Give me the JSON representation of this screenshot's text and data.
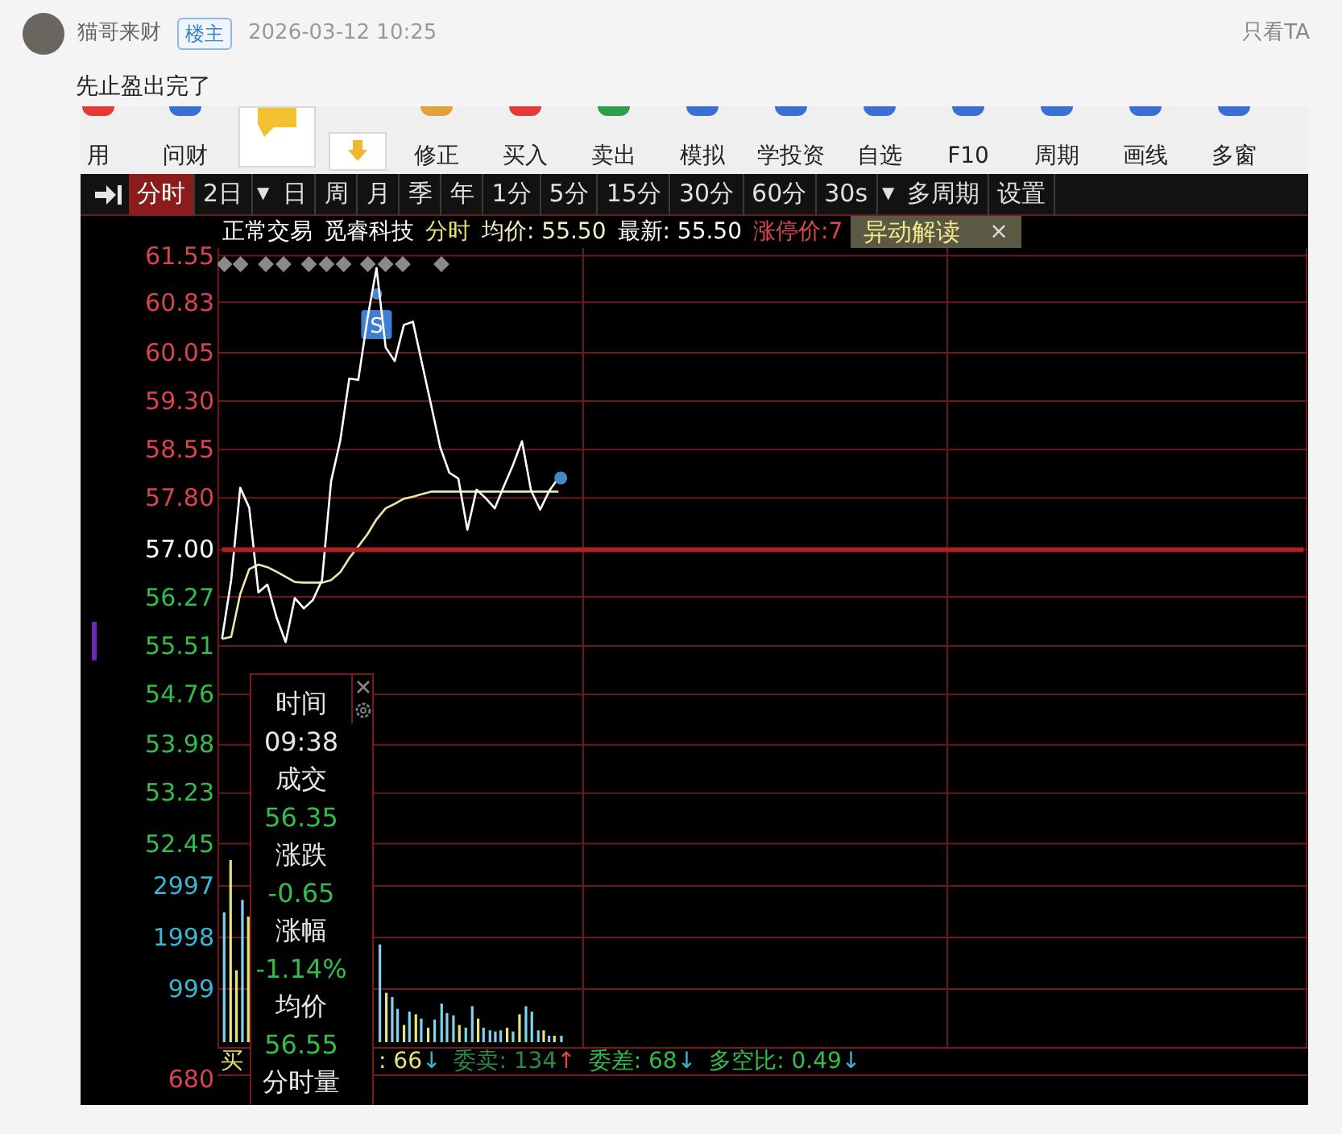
{
  "post": {
    "author": "猫哥来财",
    "badge": "楼主",
    "time": "2026-03-12 10:25",
    "only_author_link": "只看TA",
    "text": "先止盈出完了"
  },
  "screenshot": {
    "toolbar": [
      {
        "kind": "button",
        "label": "用"
      },
      {
        "kind": "button",
        "label": "问财"
      },
      {
        "kind": "wide"
      },
      {
        "kind": "small"
      },
      {
        "kind": "button",
        "label": "修正"
      },
      {
        "kind": "button",
        "label": "买入"
      },
      {
        "kind": "button",
        "label": "卖出"
      },
      {
        "kind": "button",
        "label": "模拟"
      },
      {
        "kind": "button",
        "label": "学投资"
      },
      {
        "kind": "button",
        "label": "自选"
      },
      {
        "kind": "button",
        "label": "F10"
      },
      {
        "kind": "button",
        "label": "周期"
      },
      {
        "kind": "button",
        "label": "画线"
      },
      {
        "kind": "button",
        "label": "多窗"
      }
    ],
    "period_tabs": [
      {
        "kind": "tab",
        "label": "分时",
        "selected": true
      },
      {
        "kind": "tab",
        "label": "2日",
        "selected": false
      },
      {
        "kind": "caret",
        "label": "▼",
        "selected": false
      },
      {
        "kind": "tab",
        "label": "日",
        "selected": false
      },
      {
        "kind": "tab",
        "label": "周",
        "selected": false
      },
      {
        "kind": "tab",
        "label": "月",
        "selected": false
      },
      {
        "kind": "tab",
        "label": "季",
        "selected": false
      },
      {
        "kind": "tab",
        "label": "年",
        "selected": false
      },
      {
        "kind": "tab",
        "label": "1分",
        "selected": false
      },
      {
        "kind": "tab",
        "label": "5分",
        "selected": false
      },
      {
        "kind": "tab",
        "label": "15分",
        "selected": false
      },
      {
        "kind": "tab",
        "label": "30分",
        "selected": false
      },
      {
        "kind": "tab",
        "label": "60分",
        "selected": false
      },
      {
        "kind": "tab",
        "label": "30s",
        "selected": false
      },
      {
        "kind": "caret",
        "label": "▼",
        "selected": false
      },
      {
        "kind": "tab",
        "label": "多周期",
        "selected": false
      },
      {
        "kind": "tab",
        "label": "设置",
        "selected": false
      }
    ],
    "info": [
      {
        "text": "正常交易",
        "color": "#ffffff"
      },
      {
        "text": "觅睿科技",
        "color": "#ffffff"
      },
      {
        "text": "分时",
        "color": "#e6e37a"
      },
      {
        "text": "均价: 55.50",
        "color": "#f3f0c0"
      },
      {
        "text": "最新: 55.50",
        "color": "#ffffff"
      },
      {
        "text": "涨停价:7",
        "color": "#e0474c"
      }
    ],
    "popup": {
      "label": "异动解读",
      "close": "×"
    },
    "volume_axis": [
      {
        "text": "2997"
      },
      {
        "text": "1998"
      },
      {
        "text": "999"
      }
    ],
    "lower_axis": "680",
    "price_axis": [
      {
        "color": "#d9434b"
      },
      {
        "color": "#d9434b"
      },
      {
        "color": "#d9434b"
      },
      {
        "color": "#d9434b"
      },
      {
        "color": "#d9434b"
      },
      {
        "color": "#d9434b"
      },
      {
        "color": "#ffffff"
      },
      {
        "color": "#2fbf4a"
      },
      {
        "color": "#2fbf4a"
      },
      {
        "color": "#2fbf4a"
      },
      {
        "color": "#2fbf4a"
      },
      {
        "color": "#2fbf4a"
      },
      {
        "color": "#2fbf4a"
      }
    ],
    "chart": {
      "chart_data": {
        "type": "line",
        "ylim": [
          49.3,
          61.67
        ],
        "grid": true,
        "annotations": [
          {
            "y": 60.96,
            "text": "S"
          }
        ],
        "categories": [
          null,
          null,
          null,
          null,
          null,
          null,
          null,
          null,
          null,
          null,
          null,
          null,
          null,
          null,
          null,
          null,
          null,
          null,
          null,
          null,
          null,
          null,
          null,
          null,
          null,
          null,
          null,
          null,
          null,
          null,
          null,
          null,
          null,
          null,
          null,
          null,
          null,
          null,
          null,
          null,
          null,
          null,
          null,
          null,
          null,
          null,
          null,
          null,
          null,
          null,
          null,
          null,
          null,
          null,
          null,
          null,
          null,
          null,
          null,
          null,
          null,
          null,
          null,
          null,
          null,
          null,
          null,
          null,
          null,
          null,
          null,
          null,
          null,
          null,
          null,
          null,
          null,
          null,
          null,
          null,
          null,
          null,
          null,
          null,
          null,
          null,
          null,
          null,
          null,
          null,
          null,
          null,
          null,
          null,
          null,
          null,
          null,
          null,
          null,
          null,
          null,
          null,
          null,
          null,
          null,
          null,
          null,
          null,
          null,
          null,
          null,
          null,
          null,
          null,
          null,
          null,
          null,
          null,
          null,
          null
        ],
        "yticks": [
          {
            "value": 61.55,
            "label": "61.55"
          },
          {
            "value": 60.83,
            "label": "60.83"
          },
          {
            "value": 60.05,
            "label": "60.05"
          },
          {
            "value": 59.3,
            "label": "59.30"
          },
          {
            "value": 58.55,
            "label": "58.55"
          },
          {
            "value": 57.8,
            "label": "57.80"
          },
          {
            "value": 57.0,
            "label": "57.00"
          },
          {
            "value": 56.27,
            "label": "56.27"
          },
          {
            "value": 55.51,
            "label": "55.51"
          },
          {
            "value": 54.76,
            "label": "54.76"
          },
          {
            "value": 53.98,
            "label": "53.98"
          },
          {
            "value": 53.23,
            "label": "53.23"
          },
          {
            "value": 52.45,
            "label": "52.45"
          }
        ],
        "series": [
          {
            "color": "#b01f24",
            "values": [
              57.0,
              57.0,
              57.0,
              57.0,
              57.0,
              57.0,
              57.0,
              57.0,
              57.0,
              57.0,
              57.0,
              57.0,
              57.0,
              57.0,
              57.0,
              57.0,
              57.0,
              57.0,
              57.0,
              57.0,
              57.0,
              57.0,
              57.0,
              57.0,
              57.0,
              57.0,
              57.0,
              57.0,
              57.0,
              57.0,
              57.0,
              57.0,
              57.0,
              57.0,
              57.0,
              57.0,
              57.0,
              57.0,
              57.0,
              57.0,
              57.0,
              57.0,
              57.0,
              57.0,
              57.0,
              57.0,
              57.0,
              57.0,
              57.0,
              57.0,
              57.0,
              57.0,
              57.0,
              57.0,
              57.0,
              57.0,
              57.0,
              57.0,
              57.0,
              57.0,
              57.0,
              57.0,
              57.0,
              57.0,
              57.0,
              57.0,
              57.0,
              57.0,
              57.0,
              57.0,
              57.0,
              57.0,
              57.0,
              57.0,
              57.0,
              57.0,
              57.0,
              57.0,
              57.0,
              57.0,
              57.0,
              57.0,
              57.0,
              57.0,
              57.0,
              57.0,
              57.0,
              57.0,
              57.0,
              57.0,
              57.0,
              57.0,
              57.0,
              57.0,
              57.0,
              57.0,
              57.0,
              57.0,
              57.0,
              57.0,
              57.0,
              57.0,
              57.0,
              57.0,
              57.0,
              57.0,
              57.0,
              57.0,
              57.0,
              57.0,
              57.0,
              57.0,
              57.0,
              57.0,
              57.0,
              57.0,
              57.0,
              57.0,
              57.0,
              57.0
            ]
          },
          {
            "color": "#ffffff",
            "values": [
              55.62,
              56.53,
              57.96,
              57.65,
              56.34,
              56.46,
              55.95,
              55.57,
              56.25,
              56.09,
              56.22,
              56.53,
              58.06,
              58.69,
              59.65,
              59.63,
              60.58,
              61.36,
              60.13,
              59.92,
              60.48,
              60.53,
              59.89,
              59.24,
              58.59,
              58.19,
              58.1,
              57.31,
              57.93,
              57.8,
              57.64,
              57.98,
              58.31,
              58.68,
              57.92,
              57.62,
              57.91,
              58.11,
              null,
              null,
              null,
              null,
              null,
              null,
              null,
              null,
              null,
              null,
              null,
              null,
              null,
              null,
              null,
              null,
              null,
              null,
              null,
              null,
              null,
              null,
              null,
              null,
              null,
              null,
              null,
              null,
              null,
              null,
              null,
              null,
              null,
              null,
              null,
              null,
              null,
              null,
              null,
              null,
              null,
              null,
              null,
              null,
              null,
              null,
              null,
              null,
              null,
              null,
              null,
              null,
              null,
              null,
              null,
              null,
              null,
              null,
              null,
              null,
              null,
              null,
              null,
              null,
              null,
              null,
              null,
              null,
              null,
              null,
              null,
              null,
              null,
              null,
              null,
              null,
              null,
              null,
              null,
              null,
              null,
              null
            ]
          },
          {
            "color": "#efe6a8",
            "values": [
              55.62,
              55.65,
              56.31,
              56.7,
              56.77,
              56.73,
              56.66,
              56.58,
              56.5,
              56.49,
              56.49,
              56.49,
              56.53,
              56.65,
              56.87,
              57.05,
              57.24,
              57.47,
              57.64,
              57.71,
              57.79,
              57.82,
              57.86,
              57.9,
              57.9,
              57.9,
              57.9,
              57.9,
              57.9,
              57.9,
              57.9,
              57.9,
              57.9,
              57.9,
              57.9,
              57.9,
              57.9,
              57.9,
              null,
              null,
              null,
              null,
              null,
              null,
              null,
              null,
              null,
              null,
              null,
              null,
              null,
              null,
              null,
              null,
              null,
              null,
              null,
              null,
              null,
              null,
              null,
              null,
              null,
              null,
              null,
              null,
              null,
              null,
              null,
              null,
              null,
              null,
              null,
              null,
              null,
              null,
              null,
              null,
              null,
              null,
              null,
              null,
              null,
              null,
              null,
              null,
              null,
              null,
              null,
              null,
              null,
              null,
              null,
              null,
              null,
              null,
              null,
              null,
              null,
              null,
              null,
              null,
              null,
              null,
              null,
              null,
              null,
              null,
              null,
              null,
              null,
              null,
              null,
              null,
              null,
              null,
              null,
              null,
              null,
              null
            ]
          }
        ]
      }
    },
    "tooltip": [
      {
        "text": "时间",
        "color": "#e6e6e6"
      },
      {
        "text": "09:38",
        "color": "#e6e6e6"
      },
      {
        "text": "成交",
        "color": "#e6e6e6"
      },
      {
        "text": "56.35",
        "color": "#2fbf4a"
      },
      {
        "text": "涨跌",
        "color": "#e6e6e6"
      },
      {
        "text": "-0.65",
        "color": "#2fbf4a"
      },
      {
        "text": "涨幅",
        "color": "#e6e6e6"
      },
      {
        "text": "-1.14%",
        "color": "#2fbf4a"
      },
      {
        "text": "均价",
        "color": "#e6e6e6"
      },
      {
        "text": "56.55",
        "color": "#2fbf4a"
      },
      {
        "text": "分时量",
        "color": "#e6e6e6"
      }
    ],
    "status_bar": [
      {
        "text": "买",
        "color": "#e6e37a"
      },
      {
        "text": ": 66",
        "color": "#e6e37a"
      },
      {
        "text": "↓",
        "color": "#39b6d6"
      },
      {
        "text": "委卖: 134",
        "color": "#2a8a4a"
      },
      {
        "text": "↑",
        "color": "#e0474c"
      },
      {
        "text": "委差: 68",
        "color": "#2fbf4a"
      },
      {
        "text": "↓",
        "color": "#39b6d6"
      },
      {
        "text": "多空比: 0.49",
        "color": "#2fbf4a"
      },
      {
        "text": "↓",
        "color": "#39b6d6"
      }
    ]
  }
}
